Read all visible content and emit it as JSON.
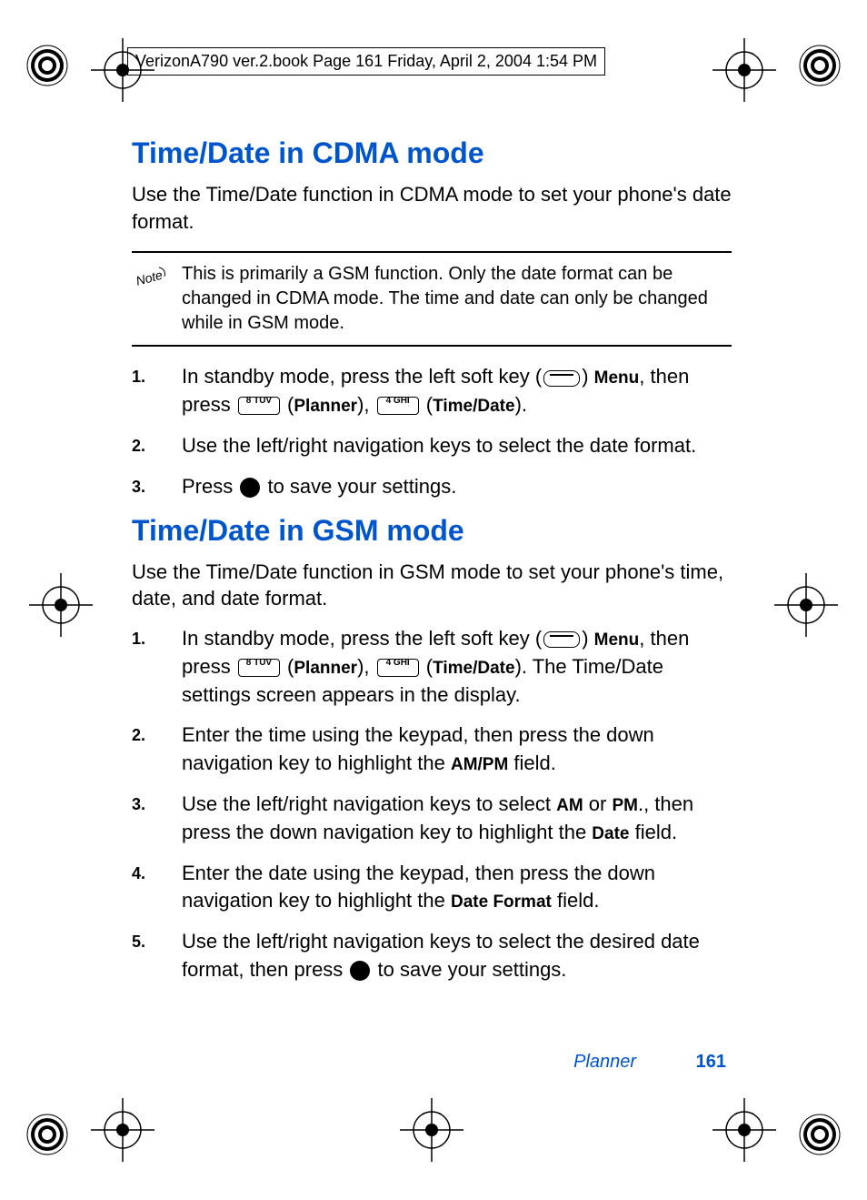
{
  "header": "VerizonA790 ver.2.book  Page 161  Friday, April 2, 2004  1:54 PM",
  "section1": {
    "heading": "Time/Date in CDMA mode",
    "intro": "Use the Time/Date function in CDMA mode to set your phone's date format.",
    "note": "This is primarily a GSM function. Only the date format can be changed in CDMA mode. The time and date can only be changed while in GSM mode.",
    "steps": [
      {
        "num": "1.",
        "pre": "In standby mode, press the left soft key (",
        "post1": ") ",
        "menu": "Menu",
        "then": ", then press ",
        "k1label": "8 TUV",
        "p1": " (",
        "planner": "Planner",
        "p2": "), ",
        "k2label": "4 GHI",
        "p3": " (",
        "timedate": "Time/Date",
        "p4": ")."
      },
      {
        "num": "2.",
        "text": "Use the left/right navigation keys to select the date format."
      },
      {
        "num": "3.",
        "pre": "Press ",
        "post": " to save your settings."
      }
    ]
  },
  "section2": {
    "heading": "Time/Date in GSM mode",
    "intro": "Use the Time/Date function in GSM mode to set your phone's time, date, and date format.",
    "steps": [
      {
        "num": "1.",
        "pre": "In standby mode, press the left soft key (",
        "post1": ") ",
        "menu": "Menu",
        "then": ", then press ",
        "k1label": "8 TUV",
        "p1": " (",
        "planner": "Planner",
        "p2": "), ",
        "k2label": "4 GHI",
        "p3": " (",
        "timedate": "Time/Date",
        "p4": "). The Time/Date settings screen appears in the display."
      },
      {
        "num": "2.",
        "t1": "Enter the time using the keypad, then press the down navigation key to highlight the ",
        "b1": "AM/PM",
        "t2": " field."
      },
      {
        "num": "3.",
        "t1": "Use the left/right navigation keys to select ",
        "b1": "AM",
        "t2": " or ",
        "b2": "PM",
        "t3": "., then press the down navigation key to highlight the ",
        "b3": "Date",
        "t4": " field."
      },
      {
        "num": "4.",
        "t1": "Enter the date using the keypad, then press the down navigation key to highlight the ",
        "b1": "Date Format",
        "t2": " field."
      },
      {
        "num": "5.",
        "t1": "Use the left/right navigation keys to select the desired date format, then press ",
        "t2": " to save your settings."
      }
    ]
  },
  "footer": {
    "section": "Planner",
    "page": "161"
  },
  "note_label": "Note"
}
